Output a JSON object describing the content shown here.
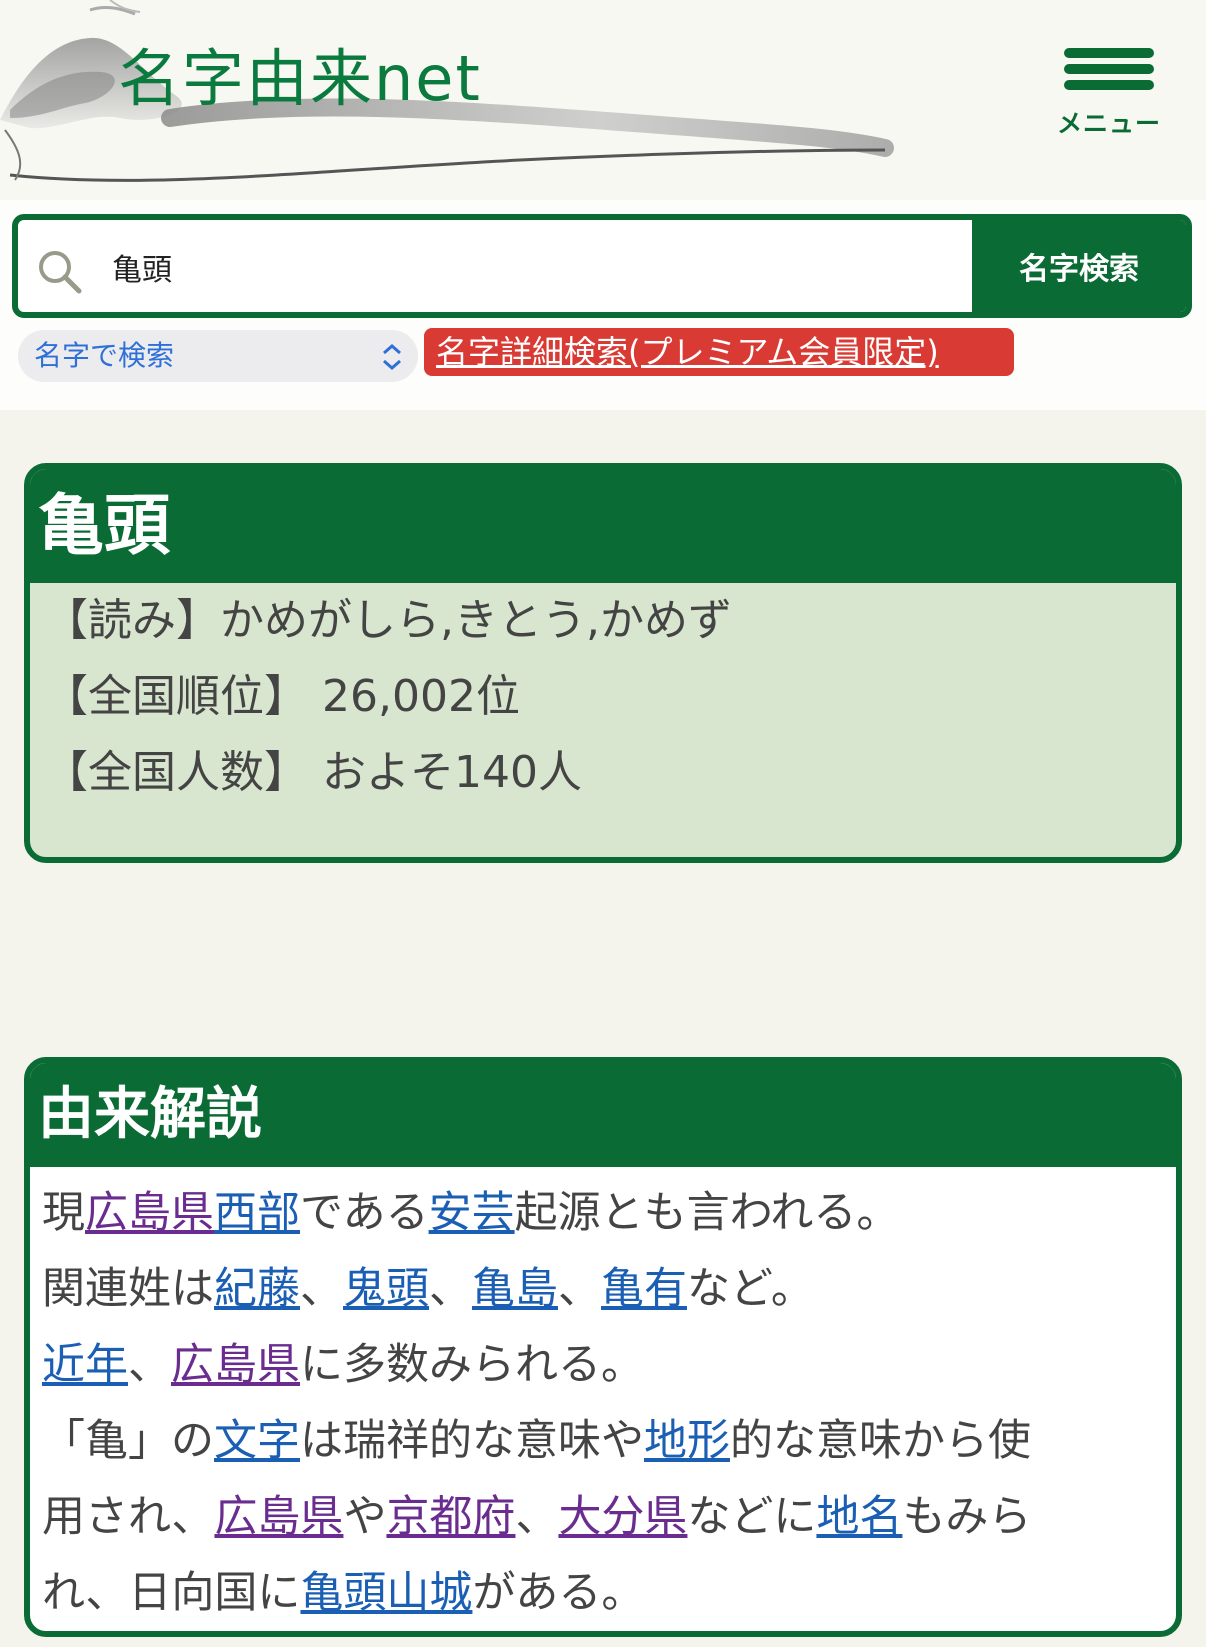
{
  "header": {
    "logo_text": "名字由来net",
    "menu_label": "メニュー"
  },
  "search": {
    "query": "亀頭",
    "button_label": "名字検索",
    "select_value": "名字で検索",
    "premium_link": "名字詳細検索(プレミアム会員限定)"
  },
  "surname": {
    "name": "亀頭",
    "reading": "【読み】かめがしら,きとう,かめず",
    "rank": "【全国順位】 26,002位",
    "population": "【全国人数】 およそ140人"
  },
  "origin": {
    "title": "由来解説",
    "lines": [
      [
        {
          "t": "現"
        },
        {
          "t": "広島県",
          "link": "purple"
        },
        {
          "t": "西部",
          "link": "blue"
        },
        {
          "t": "である"
        },
        {
          "t": "安芸",
          "link": "blue"
        },
        {
          "t": "起源とも言われる。"
        }
      ],
      [
        {
          "t": "関連姓は"
        },
        {
          "t": "紀藤",
          "link": "blue"
        },
        {
          "t": "、"
        },
        {
          "t": "鬼頭",
          "link": "blue"
        },
        {
          "t": "、"
        },
        {
          "t": "亀島",
          "link": "blue"
        },
        {
          "t": "、"
        },
        {
          "t": "亀有",
          "link": "blue"
        },
        {
          "t": "など。"
        }
      ],
      [
        {
          "t": "近年",
          "link": "blue"
        },
        {
          "t": "、"
        },
        {
          "t": "広島県",
          "link": "purple"
        },
        {
          "t": "に多数みられる。"
        }
      ],
      [
        {
          "t": "「亀」の"
        },
        {
          "t": "文字",
          "link": "blue"
        },
        {
          "t": "は瑞祥的な意味や"
        },
        {
          "t": "地形",
          "link": "blue"
        },
        {
          "t": "的な意味から使"
        }
      ],
      [
        {
          "t": "用され、"
        },
        {
          "t": "広島県",
          "link": "purple"
        },
        {
          "t": "や"
        },
        {
          "t": "京都府",
          "link": "purple"
        },
        {
          "t": "、"
        },
        {
          "t": "大分県",
          "link": "purple"
        },
        {
          "t": "などに"
        },
        {
          "t": "地名",
          "link": "blue"
        },
        {
          "t": "もみら"
        }
      ],
      [
        {
          "t": "れ、日向国に"
        },
        {
          "t": "亀頭山城",
          "link": "blue"
        },
        {
          "t": "がある。"
        }
      ]
    ]
  }
}
